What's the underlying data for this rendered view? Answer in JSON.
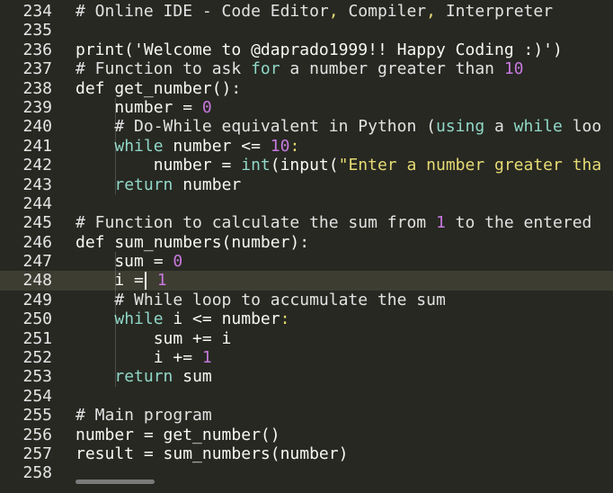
{
  "editor": {
    "active_line_index": 14,
    "lines": [
      {
        "num": "234",
        "tokens": [
          {
            "t": "comment",
            "v": "# Online IDE - Code Editor"
          },
          {
            "t": "punct",
            "v": ","
          },
          {
            "t": "comment",
            "v": " Compiler"
          },
          {
            "t": "punct",
            "v": ","
          },
          {
            "t": "comment",
            "v": " Interpreter"
          }
        ]
      },
      {
        "num": "235",
        "tokens": []
      },
      {
        "num": "236",
        "tokens": [
          {
            "t": "plain",
            "v": "print('Welcome to @daprado1999!! Happy Coding :)')"
          }
        ]
      },
      {
        "num": "237",
        "tokens": [
          {
            "t": "comment",
            "v": "# Function to ask "
          },
          {
            "t": "keyword",
            "v": "for"
          },
          {
            "t": "comment",
            "v": " a number greater than "
          },
          {
            "t": "number",
            "v": "10"
          }
        ]
      },
      {
        "num": "238",
        "tokens": [
          {
            "t": "plain",
            "v": "def get_number():"
          }
        ]
      },
      {
        "num": "239",
        "tokens": [
          {
            "t": "plain",
            "v": "    number = "
          },
          {
            "t": "number",
            "v": "0"
          }
        ]
      },
      {
        "num": "240",
        "tokens": [
          {
            "t": "comment",
            "v": "    # Do-While equivalent in Python ("
          },
          {
            "t": "keyword",
            "v": "using"
          },
          {
            "t": "comment",
            "v": " a "
          },
          {
            "t": "keyword",
            "v": "while"
          },
          {
            "t": "comment",
            "v": " loo"
          }
        ]
      },
      {
        "num": "241",
        "tokens": [
          {
            "t": "plain",
            "v": "    "
          },
          {
            "t": "keyword",
            "v": "while"
          },
          {
            "t": "plain",
            "v": " number <= "
          },
          {
            "t": "number",
            "v": "10"
          },
          {
            "t": "punct",
            "v": ":"
          }
        ]
      },
      {
        "num": "242",
        "tokens": [
          {
            "t": "plain",
            "v": "        number = "
          },
          {
            "t": "builtin",
            "v": "int"
          },
          {
            "t": "plain",
            "v": "(input("
          },
          {
            "t": "string",
            "v": "\"Enter a number greater tha"
          }
        ]
      },
      {
        "num": "243",
        "tokens": [
          {
            "t": "plain",
            "v": "    "
          },
          {
            "t": "keyword",
            "v": "return"
          },
          {
            "t": "plain",
            "v": " number"
          }
        ]
      },
      {
        "num": "244",
        "tokens": []
      },
      {
        "num": "245",
        "tokens": [
          {
            "t": "comment",
            "v": "# Function to calculate the sum from "
          },
          {
            "t": "number",
            "v": "1"
          },
          {
            "t": "comment",
            "v": " to the entered "
          }
        ]
      },
      {
        "num": "246",
        "tokens": [
          {
            "t": "plain",
            "v": "def sum_numbers(number):"
          }
        ]
      },
      {
        "num": "247",
        "tokens": [
          {
            "t": "plain",
            "v": "    sum = "
          },
          {
            "t": "number",
            "v": "0"
          }
        ]
      },
      {
        "num": "248",
        "tokens": [
          {
            "t": "plain",
            "v": "    i ="
          },
          {
            "t": "cursor",
            "v": ""
          },
          {
            "t": "plain",
            "v": " "
          },
          {
            "t": "number",
            "v": "1"
          }
        ]
      },
      {
        "num": "249",
        "tokens": [
          {
            "t": "comment",
            "v": "    # While loop to accumulate the sum"
          }
        ]
      },
      {
        "num": "250",
        "tokens": [
          {
            "t": "plain",
            "v": "    "
          },
          {
            "t": "keyword",
            "v": "while"
          },
          {
            "t": "plain",
            "v": " i <= number"
          },
          {
            "t": "punct",
            "v": ":"
          }
        ]
      },
      {
        "num": "251",
        "tokens": [
          {
            "t": "plain",
            "v": "        sum += i"
          }
        ]
      },
      {
        "num": "252",
        "tokens": [
          {
            "t": "plain",
            "v": "        i += "
          },
          {
            "t": "number",
            "v": "1"
          }
        ]
      },
      {
        "num": "253",
        "tokens": [
          {
            "t": "plain",
            "v": "    "
          },
          {
            "t": "keyword",
            "v": "return"
          },
          {
            "t": "plain",
            "v": " sum"
          }
        ]
      },
      {
        "num": "254",
        "tokens": []
      },
      {
        "num": "255",
        "tokens": [
          {
            "t": "comment",
            "v": "# Main program"
          }
        ]
      },
      {
        "num": "256",
        "tokens": [
          {
            "t": "plain",
            "v": "number = get_number()"
          }
        ]
      },
      {
        "num": "257",
        "tokens": [
          {
            "t": "plain",
            "v": "result = sum_numbers(number)"
          }
        ]
      },
      {
        "num": "258",
        "tokens": []
      }
    ]
  },
  "colors": {
    "background": "#272822",
    "active_line": "#3e3d32",
    "keyword": "#90d8c8",
    "number": "#c678dd",
    "string": "#e6db74"
  }
}
